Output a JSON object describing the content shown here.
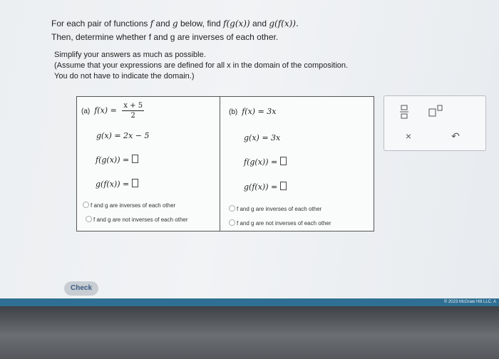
{
  "prompt": {
    "line1_pre": "For each pair of functions ",
    "f": "f",
    "and": "and",
    "g": "g",
    "line1_mid": "below, find",
    "fog": "f(g(x))",
    "and2": "and",
    "gof": "g(f(x)).",
    "line2": "Then, determine whether f and g are inverses of each other."
  },
  "note": {
    "line1": "Simplify your answers as much as possible.",
    "line2": "(Assume that your expressions are defined for all x in the domain of the composition.",
    "line3": "You do not have to indicate the domain.)"
  },
  "part_a": {
    "label": "(a)",
    "f_lhs": "f(x) =",
    "f_num": "x + 5",
    "f_den": "2",
    "g_def": "g(x) = 2x − 5",
    "fog_lhs": "f(g(x)) =",
    "gof_lhs": "g(f(x)) =",
    "opt_inverse": "f and g are inverses of each other",
    "opt_not_inverse": "f and g are not inverses of each other"
  },
  "part_b": {
    "label": "(b)",
    "f_def": "f(x) = 3x",
    "g_def": "g(x) = 3x",
    "fog_lhs": "f(g(x)) =",
    "gof_lhs": "g(f(x)) =",
    "opt_inverse": "f and g are inverses of each other",
    "opt_not_inverse": "f and g are not inverses of each other"
  },
  "tools": {
    "fraction_icon": "fraction-icon",
    "exponent_icon": "exponent-icon",
    "clear_symbol": "×",
    "undo_symbol": "↶"
  },
  "check_button": "Check",
  "copyright": "© 2023 McGraw Hill LLC. A"
}
